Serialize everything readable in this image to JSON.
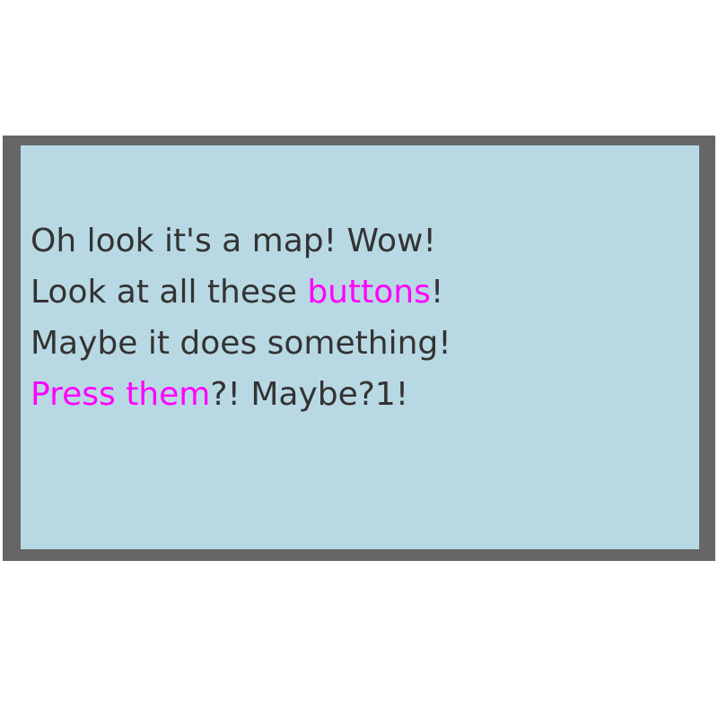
{
  "colors": {
    "frame": "#666666",
    "panel_background": "#b8d9e3",
    "text": "#333333",
    "highlight": "#ff00ff",
    "page_background": "#ffffff"
  },
  "message": {
    "line1": "Oh look it's a map! Wow!",
    "line2_before": "Look at all these ",
    "line2_highlight": "buttons",
    "line2_after": "!",
    "line3": "Maybe it does something!",
    "line4_highlight": "Press them",
    "line4_after": "?! Maybe?1!"
  }
}
